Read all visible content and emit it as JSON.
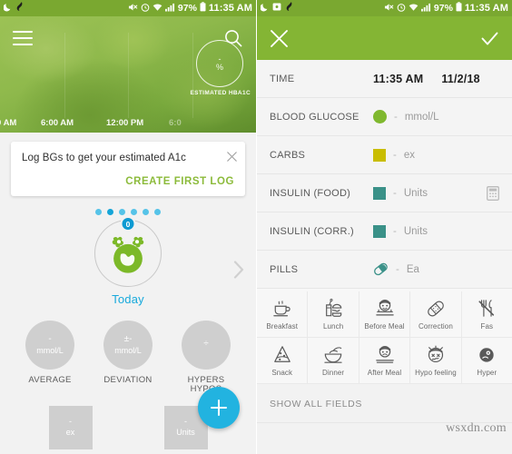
{
  "left": {
    "statusbar": {
      "icons": [
        "moon-icon",
        "app-icon"
      ],
      "right_icons": [
        "mute-icon",
        "alarm-icon",
        "wifi-icon",
        "signal-icon"
      ],
      "battery_pct": "97%",
      "time": "11:35 AM"
    },
    "topbar": {
      "menu": "menu-icon",
      "search": "search-icon"
    },
    "hero": {
      "hba1c_value": "-",
      "hba1c_unit": "%",
      "hba1c_label": "ESTIMATED HBA1C",
      "axis": [
        "0 AM",
        "6:00 AM",
        "12:00 PM",
        "6:0"
      ]
    },
    "toast": {
      "text": "Log BGs to get your estimated A1c",
      "cta": "CREATE FIRST LOG",
      "close": "close-icon"
    },
    "avatar": {
      "badge_count": "0",
      "dots_total": 6,
      "dots_active_index": 1,
      "label": "Today",
      "next": "chevron-right-icon"
    },
    "stats": [
      {
        "value": "-",
        "unit": "mmol/L",
        "label": "AVERAGE"
      },
      {
        "value": "±-",
        "unit": "mmol/L",
        "label": "DEVIATION"
      },
      {
        "value": "÷",
        "unit": "",
        "label": "HYPERS\nHYPOS"
      }
    ],
    "squares": [
      {
        "value": "-",
        "unit": "ex"
      },
      {
        "value": "-",
        "unit": "Units"
      }
    ],
    "fab": "add-entry-button"
  },
  "right": {
    "statusbar": {
      "left_icons": [
        "moon-icon",
        "message-icon",
        "app-icon"
      ],
      "right_icons": [
        "mute-icon",
        "alarm-icon",
        "wifi-icon",
        "signal-icon"
      ],
      "battery_pct": "97%",
      "time": "11:35 AM"
    },
    "actionbar": {
      "close": "close-icon",
      "confirm": "check-icon"
    },
    "rows": [
      {
        "label": "TIME",
        "type": "time",
        "value": "11:35 AM",
        "date": "11/2/18"
      },
      {
        "label": "BLOOD GLUCOSE",
        "type": "circle",
        "color": "#7fb82e",
        "value": "-",
        "unit": "mmol/L"
      },
      {
        "label": "CARBS",
        "type": "square",
        "color": "#c9bd00",
        "value": "-",
        "unit": "ex"
      },
      {
        "label": "INSULIN (FOOD)",
        "type": "square",
        "color": "#3a9188",
        "value": "-",
        "unit": "Units",
        "trailing_icon": "calculator-icon"
      },
      {
        "label": "INSULIN (CORR.)",
        "type": "square",
        "color": "#3a9188",
        "value": "-",
        "unit": "Units"
      },
      {
        "label": "PILLS",
        "type": "pill",
        "color": "#3a9188",
        "value": "-",
        "unit": "Ea"
      }
    ],
    "tags": [
      [
        {
          "label": "Breakfast",
          "icon": "coffee-cup-icon"
        },
        {
          "label": "Lunch",
          "icon": "burger-drink-icon"
        },
        {
          "label": "Before Meal",
          "icon": "face-before-meal-icon"
        },
        {
          "label": "Correction",
          "icon": "bandage-icon"
        },
        {
          "label": "Fas",
          "icon": "fasting-icon"
        }
      ],
      [
        {
          "label": "Snack",
          "icon": "pizza-slice-icon"
        },
        {
          "label": "Dinner",
          "icon": "bowl-cutlery-icon"
        },
        {
          "label": "After Meal",
          "icon": "face-after-meal-icon"
        },
        {
          "label": "Hypo feeling",
          "icon": "face-dizzy-icon"
        },
        {
          "label": "Hyper",
          "icon": "face-hyper-icon"
        }
      ]
    ],
    "show_all": "SHOW ALL FIELDS",
    "watermark": "wsxdn.com"
  },
  "colors": {
    "brand_green": "#84b534",
    "status_green": "#7aa830",
    "accent_blue": "#22b3e0",
    "cta_green": "#8cbb3b",
    "teal": "#3a9188",
    "yellow": "#c9bd00",
    "bg_light": "#f4f4f4"
  }
}
